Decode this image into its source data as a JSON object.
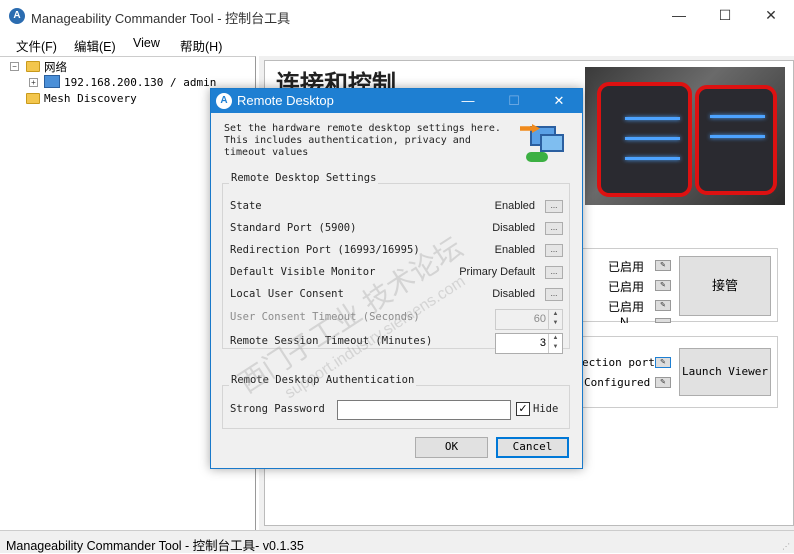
{
  "window": {
    "title": "Manageability Commander Tool - 控制台工具",
    "controls": {
      "minimize": "—",
      "maximize": "☐",
      "close": "✕"
    }
  },
  "menu": [
    "文件(F)",
    "编辑(E)",
    "View",
    "帮助(H)"
  ],
  "tree": {
    "root": "网络",
    "node": "192.168.200.130 / admin",
    "mesh": "Mesh Discovery"
  },
  "right_pane": {
    "heading": "连接和控制",
    "status_rows": [
      "已启用",
      "已启用",
      "已启用"
    ],
    "takeover_button": "接管",
    "row_cut": "N",
    "redirection_text": "ection port",
    "configured_text": "Configured",
    "launch_viewer_button": "Launch Viewer"
  },
  "status_bar": {
    "text": "Manageability Commander Tool - 控制台工具- v0.1.35"
  },
  "dialog": {
    "title": "Remote Desktop",
    "description": "Set the hardware remote desktop settings here. This includes authentication, privacy and timeout values",
    "settings_group": "Remote Desktop Settings",
    "rows": [
      {
        "label": "State",
        "value": "Enabled",
        "button": "..."
      },
      {
        "label": "Standard Port (5900)",
        "value": "Disabled",
        "button": "..."
      },
      {
        "label": "Redirection Port (16993/16995)",
        "value": "Enabled",
        "button": "..."
      },
      {
        "label": "Default Visible Monitor",
        "value": "Primary Default",
        "button": "..."
      },
      {
        "label": "Local User Consent",
        "value": "Disabled",
        "button": "..."
      }
    ],
    "consent_timeout": {
      "label": "User Consent Timeout (Seconds)",
      "value": "60"
    },
    "session_timeout": {
      "label": "Remote Session Timeout (Minutes)",
      "value": "3"
    },
    "auth_group": "Remote Desktop Authentication",
    "password_label": "Strong Password",
    "password_value": "",
    "hide_label": "Hide",
    "hide_checked": true,
    "ok_button": "OK",
    "cancel_button": "Cancel"
  },
  "watermark": {
    "line1": "西门子工业 技术论坛",
    "line2": "support.industry.siemens.com"
  },
  "colors": {
    "accent": "#1e7fd2",
    "dialog_bg": "#f0f0f0"
  }
}
